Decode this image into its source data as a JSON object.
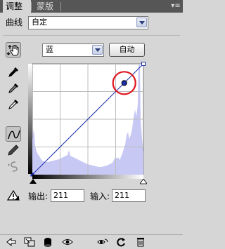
{
  "tabs": [
    {
      "label": "调整",
      "active": true
    },
    {
      "label": "蒙版",
      "active": false
    }
  ],
  "panel_menu_icon": "panel-menu-icon",
  "header": {
    "label": "曲线",
    "preset_value": "自定"
  },
  "channel": {
    "value": "蓝"
  },
  "auto_button": "自动",
  "tools": [
    "on-image-adjust-icon",
    "black-point-eyedropper-icon",
    "gray-point-eyedropper-icon",
    "white-point-eyedropper-icon",
    "curve-point-tool-icon",
    "pencil-draw-icon",
    "smooth-icon",
    "clipping-warning-icon"
  ],
  "curve": {
    "channel_color": "#1a2fa8",
    "histogram_color": "#c8c8f4",
    "highlight_ring_color": "#e0141e",
    "control_point_input": 211,
    "control_point_output": 211
  },
  "io": {
    "output_label": "输出:",
    "output_value": "211",
    "input_label": "输入:",
    "input_value": "211"
  },
  "bottom_icons": [
    "back-arrow-icon",
    "layer-expand-icon",
    "clip-to-layer-icon",
    "visibility-eye-icon",
    "view-previous-icon",
    "reset-icon",
    "trash-icon"
  ]
}
